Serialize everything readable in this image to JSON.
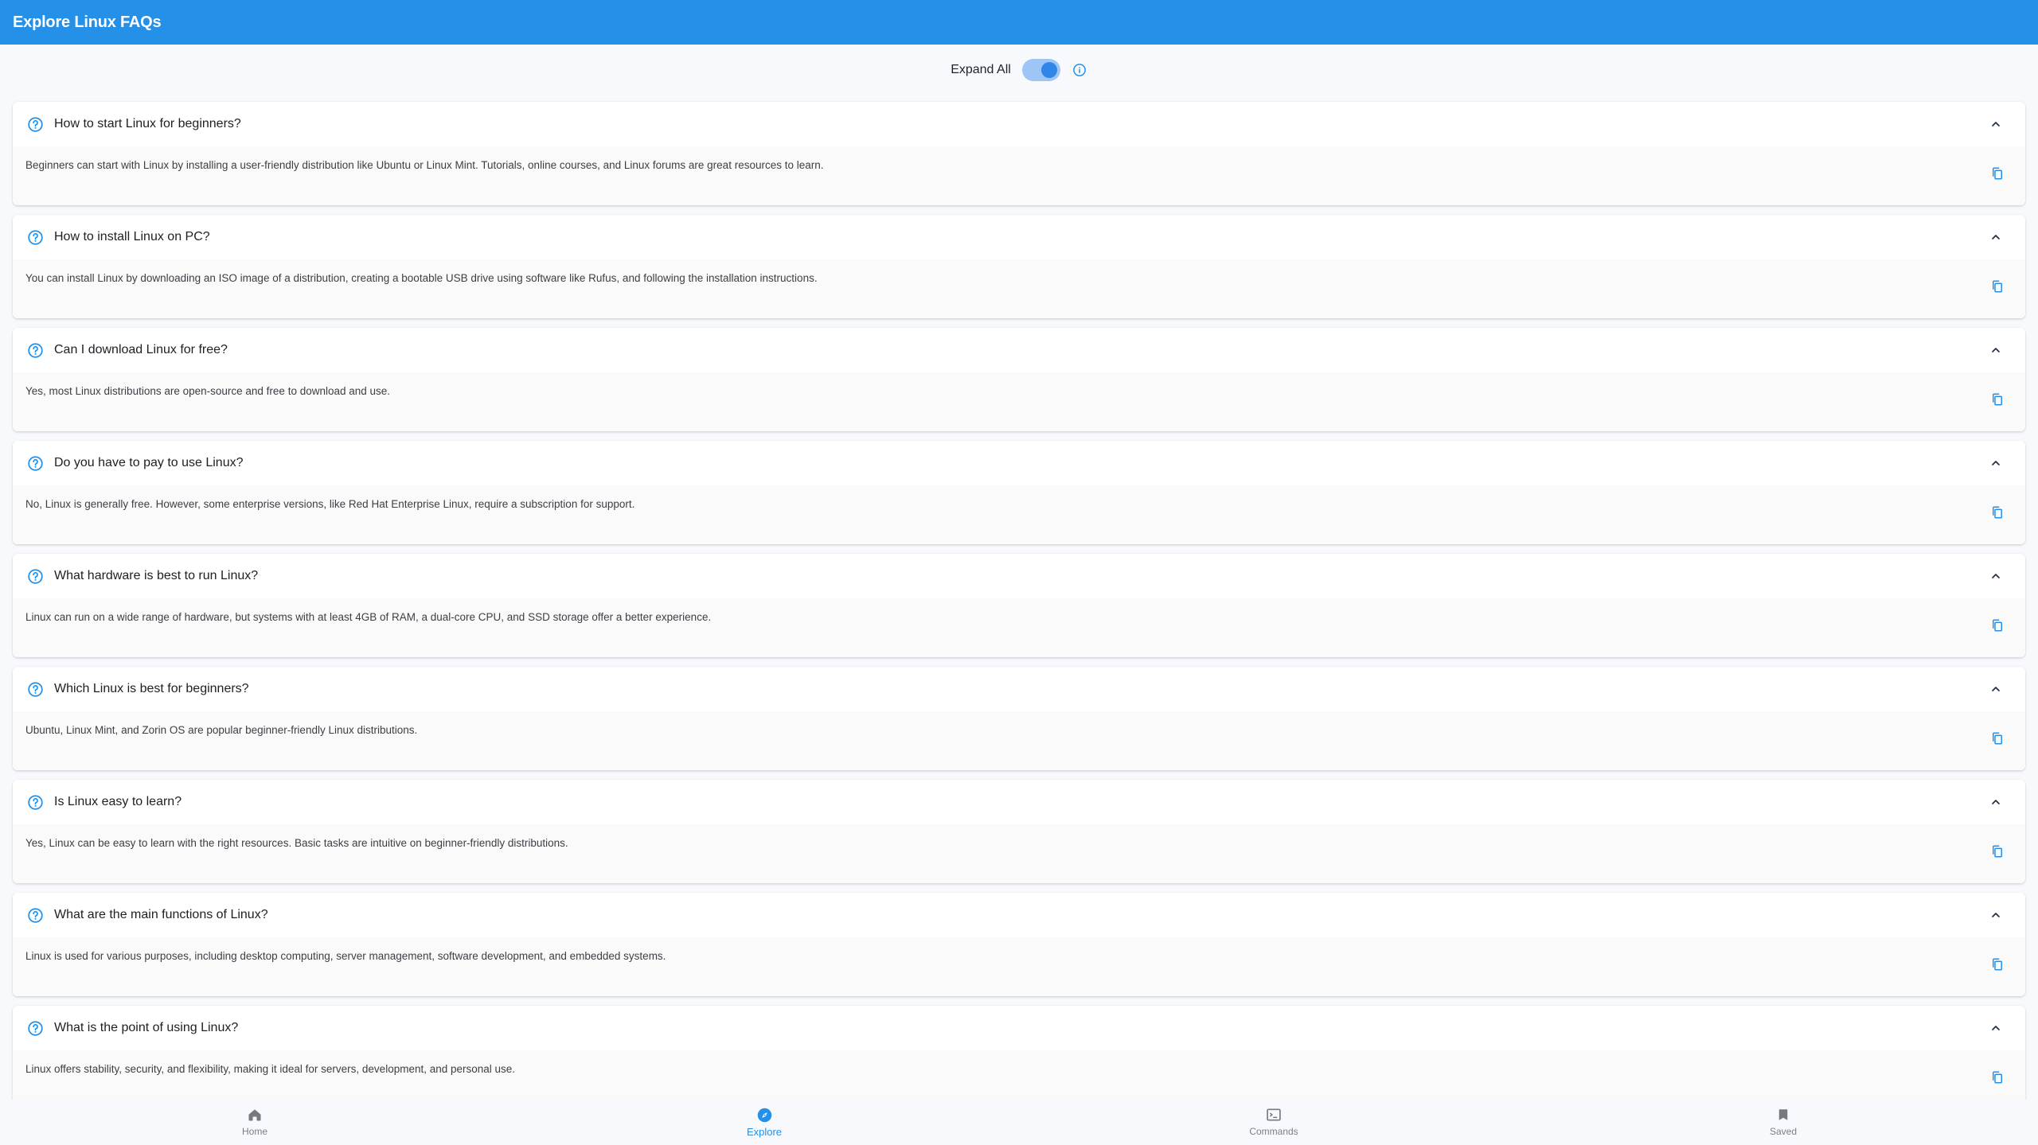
{
  "app": {
    "title": "Explore Linux FAQs",
    "accent_color": "#2590e8"
  },
  "expand_all": {
    "label": "Expand All",
    "enabled": true,
    "info_icon": "info-icon"
  },
  "faqs": [
    {
      "question": "How to start Linux for beginners?",
      "answer": "Beginners can start with Linux by installing a user-friendly distribution like Ubuntu or Linux Mint. Tutorials, online courses, and Linux forums are great resources to learn."
    },
    {
      "question": "How to install Linux on PC?",
      "answer": "You can install Linux by downloading an ISO image of a distribution, creating a bootable USB drive using software like Rufus, and following the installation instructions."
    },
    {
      "question": "Can I download Linux for free?",
      "answer": "Yes, most Linux distributions are open-source and free to download and use."
    },
    {
      "question": "Do you have to pay to use Linux?",
      "answer": "No, Linux is generally free. However, some enterprise versions, like Red Hat Enterprise Linux, require a subscription for support."
    },
    {
      "question": "What hardware is best to run Linux?",
      "answer": "Linux can run on a wide range of hardware, but systems with at least 4GB of RAM, a dual-core CPU, and SSD storage offer a better experience."
    },
    {
      "question": "Which Linux is best for beginners?",
      "answer": "Ubuntu, Linux Mint, and Zorin OS are popular beginner-friendly Linux distributions."
    },
    {
      "question": "Is Linux easy to learn?",
      "answer": "Yes, Linux can be easy to learn with the right resources. Basic tasks are intuitive on beginner-friendly distributions."
    },
    {
      "question": "What are the main functions of Linux?",
      "answer": "Linux is used for various purposes, including desktop computing, server management, software development, and embedded systems."
    },
    {
      "question": "What is the point of using Linux?",
      "answer": "Linux offers stability, security, and flexibility, making it ideal for servers, development, and personal use."
    }
  ],
  "bottom_nav": {
    "items": [
      {
        "label": "Home",
        "icon": "home-icon",
        "active": false
      },
      {
        "label": "Explore",
        "icon": "compass-icon",
        "active": true
      },
      {
        "label": "Commands",
        "icon": "terminal-icon",
        "active": false
      },
      {
        "label": "Saved",
        "icon": "bookmark-icon",
        "active": false
      }
    ]
  }
}
